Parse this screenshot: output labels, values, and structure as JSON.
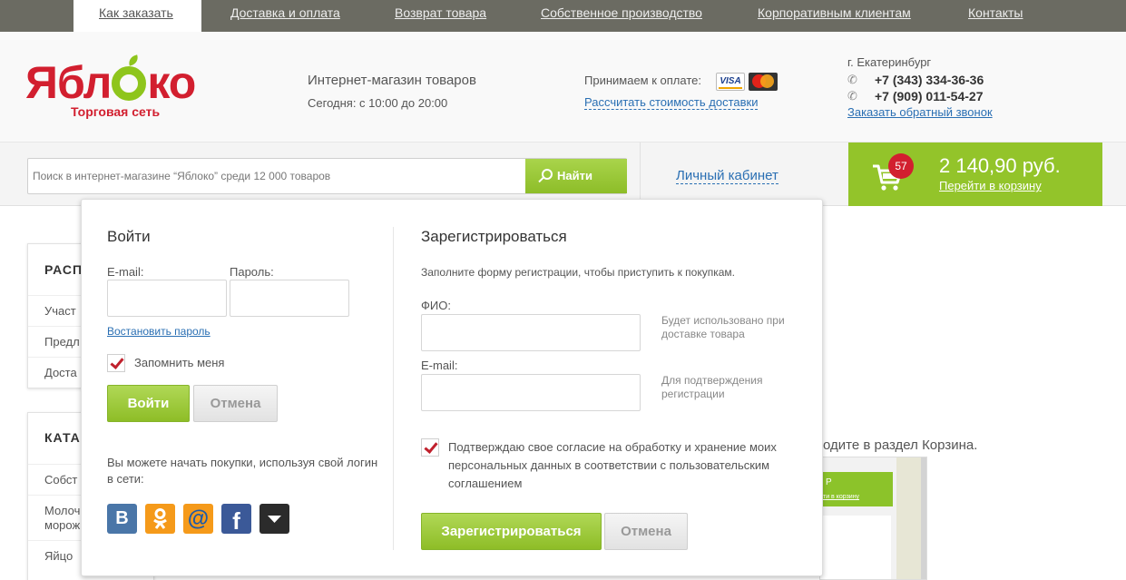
{
  "topnav": {
    "items": [
      "Как заказать",
      "Доставка и оплата",
      "Возврат товара",
      "Собственное производство",
      "Корпоративным клиентам",
      "Контакты"
    ],
    "active": "Как заказать"
  },
  "logo": {
    "left": "Ябл",
    "right": "ко",
    "subtitle": "Торговая сеть"
  },
  "shop": {
    "title": "Интернет-магазин товаров",
    "hours": "Сегодня: с 10:00 до 20:00"
  },
  "payment": {
    "label": "Принимаем к оплате:",
    "visa": "VISA",
    "calc_link": "Рассчитать стоимость доставки"
  },
  "contacts": {
    "city": "г. Екатеринбург",
    "phone1": "+7 (343) 334-36-36",
    "phone2": "+7 (909) 011-54-27",
    "callback": "Заказать обратный звонок"
  },
  "search": {
    "placeholder": "Поиск в интернет-магазине “Яблоко” среди 12 000 товаров",
    "button": "Найти"
  },
  "account": {
    "label": "Личный кабинет"
  },
  "cart": {
    "count": "57",
    "sum": "2 140,90 руб.",
    "link": "Перейти в корзину"
  },
  "background": {
    "box1": {
      "heading": "РАСП",
      "items": [
        "Участ",
        "Предл",
        "Доста"
      ]
    },
    "box2": {
      "heading": "КАТА",
      "items": [
        "Собст",
        "Молоч",
        "морож",
        "Яйцо"
      ]
    },
    "text": "одите в раздел Корзина.",
    "shot": {
      "title": "Р",
      "link": "ти в корзину"
    }
  },
  "login": {
    "title": "Войти",
    "email_label": "E-mail:",
    "password_label": "Пароль:",
    "restore_link": "Востановить пароль",
    "remember": "Запомнить меня",
    "submit": "Войти",
    "cancel": "Отмена",
    "social_text": "Вы можете начать покупки, используя свой логин в сети:",
    "social": [
      "В",
      "ok",
      "@",
      "f",
      "more"
    ]
  },
  "register": {
    "title": "Зарегистрироваться",
    "intro": "Заполните форму регистрации, чтобы приступить к покупкам.",
    "fio_label": "ФИО:",
    "fio_hint": "Будет использовано при доставке товара",
    "email_label": "E-mail:",
    "email_hint": "Для подтверждения регистрации",
    "agree": "Подтверждаю свое согласие на обработку и хранение моих персональных данных в соответствии с пользовательским соглашением",
    "submit": "Зарегистрироваться",
    "cancel": "Отмена"
  },
  "colors": {
    "green": "#93c42a",
    "red": "#d21f2f",
    "nav": "#6b6b62",
    "link": "#2a6fb3"
  }
}
